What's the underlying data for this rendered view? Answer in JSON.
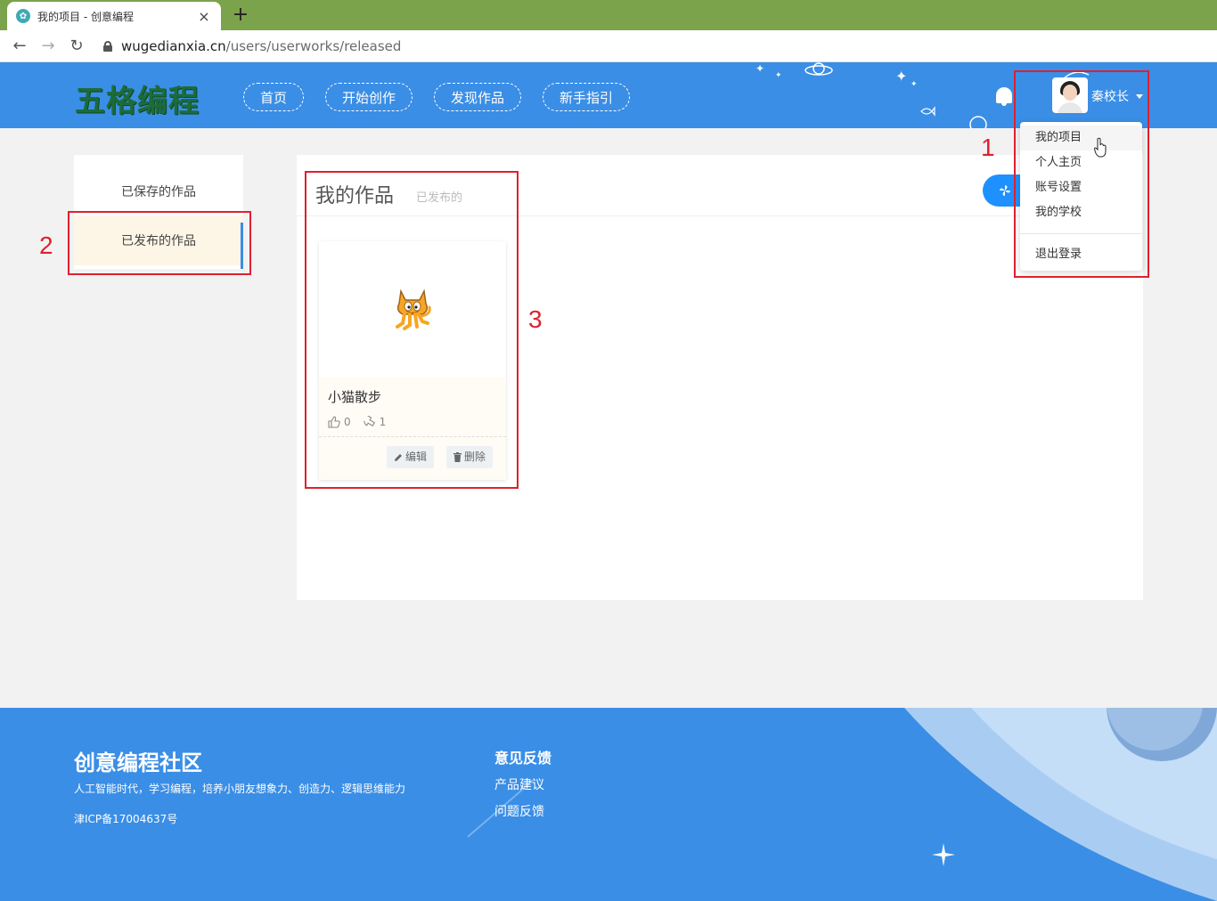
{
  "browser": {
    "tab_title": "我的项目 - 创意编程",
    "url_host": "wugedianxia.cn",
    "url_path": "/users/userworks/released"
  },
  "header": {
    "logo": "五格编程",
    "nav": [
      "首页",
      "开始创作",
      "发现作品",
      "新手指引"
    ],
    "username": "秦校长"
  },
  "dropdown": {
    "items": [
      "我的项目",
      "个人主页",
      "账号设置",
      "我的学校"
    ],
    "logout": "退出登录"
  },
  "sidebar": {
    "items": [
      "已保存的作品",
      "已发布的作品"
    ],
    "active_index": 1
  },
  "main": {
    "title": "我的作品",
    "subtitle": "已发布的",
    "works": [
      {
        "name": "小猫散步",
        "likes": "0",
        "shares": "1",
        "edit_label": "编辑",
        "delete_label": "删除"
      }
    ]
  },
  "annotations": [
    "1",
    "2",
    "3"
  ],
  "footer": {
    "title": "创意编程社区",
    "description": "人工智能时代，学习编程，培养小朋友想象力、创造力、逻辑思维能力",
    "icp": "津ICP备17004637号",
    "feedback_title": "意见反馈",
    "links": [
      "产品建议",
      "问题反馈"
    ]
  },
  "colors": {
    "brand_blue": "#3a8ee6",
    "tab_strip": "#7ba34b",
    "annotation_red": "#e0202e"
  }
}
